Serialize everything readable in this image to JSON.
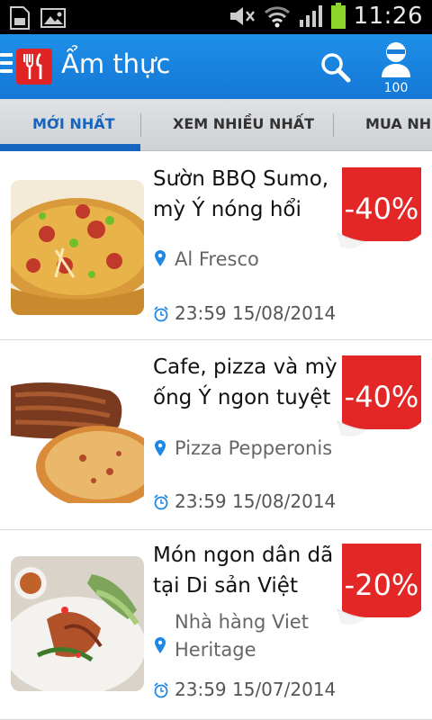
{
  "status_bar": {
    "time": "11:26"
  },
  "app_bar": {
    "title": "Ẩm thực",
    "user_count": "100"
  },
  "tabs": [
    {
      "label": "MỚI NHẤT",
      "active": true
    },
    {
      "label": "XEM NHIỀU NHẤT",
      "active": false
    },
    {
      "label": "MUA NHI",
      "active": false
    }
  ],
  "deals": [
    {
      "title_line1": "Sườn BBQ Sumo,",
      "title_line2": "mỳ Ý nóng hổi",
      "location_line1": "Al Fresco",
      "location_line2": "",
      "expiry": "23:59 15/08/2014",
      "discount": "-40%",
      "image": "pizza"
    },
    {
      "title_line1": "Cafe, pizza và mỳ",
      "title_line2": "ống Ý ngon tuyệt",
      "location_line1": "Pizza Pepperonis",
      "location_line2": "",
      "expiry": "23:59 15/08/2014",
      "discount": "-40%",
      "image": "ribs-and-pizza"
    },
    {
      "title_line1": "Món ngon dân dã",
      "title_line2": "tại Di sản Việt",
      "location_line1": "Nhà hàng Viet",
      "location_line2": "Heritage",
      "expiry": "23:59 15/07/2014",
      "discount": "-20%",
      "image": "vietnamese-platter"
    }
  ],
  "colors": {
    "app_bar": "#1a84e0",
    "active_tab": "#1565c0",
    "badge": "#e32626",
    "location_pin": "#1e88e5"
  }
}
